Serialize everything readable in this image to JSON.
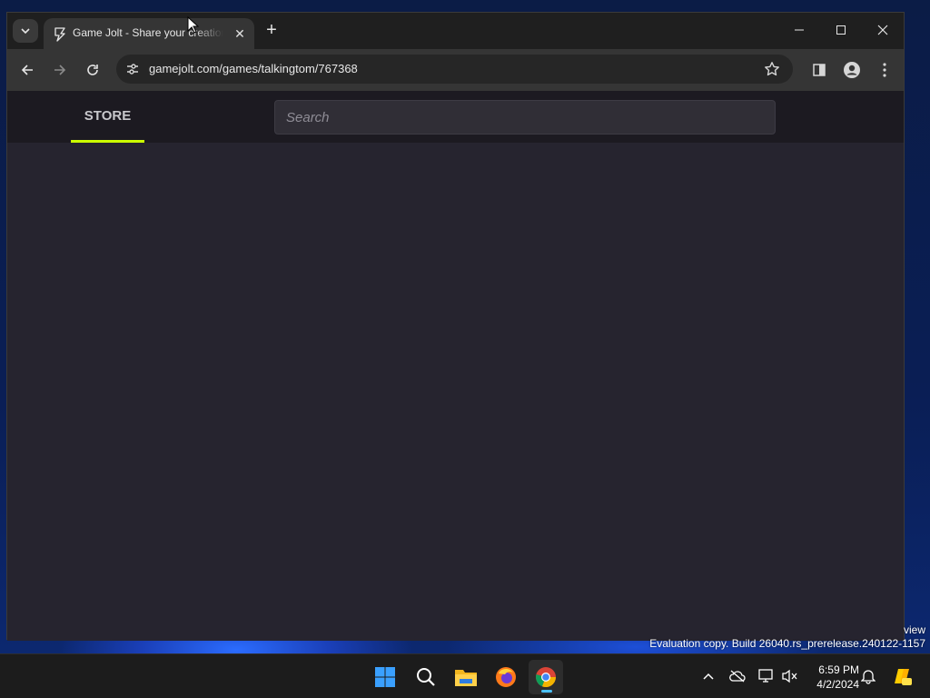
{
  "browser": {
    "tab": {
      "title": "Game Jolt - Share your creations",
      "close_glyph": "✕"
    },
    "new_tab_glyph": "+",
    "url": "gamejolt.com/games/talkingtom/767368",
    "icons": {
      "tab_search": "chevron-down-icon",
      "back": "arrow-left-icon",
      "forward": "arrow-right-icon",
      "reload": "reload-icon",
      "site_info": "tune-icon",
      "bookmark": "star-icon",
      "side_panel": "side-panel-icon",
      "profile": "profile-icon",
      "menu": "kebab-menu-icon"
    }
  },
  "site": {
    "nav": {
      "store_label": "STORE"
    },
    "search": {
      "placeholder": "Search"
    },
    "accent_color": "#ccff00"
  },
  "desktop": {
    "watermark_line1": "view",
    "watermark_line2": "Evaluation copy. Build 26040.rs_prerelease.240122-1157"
  },
  "taskbar": {
    "apps": [
      "start",
      "search",
      "file-explorer",
      "firefox",
      "chrome"
    ],
    "active_app": "chrome",
    "clock": {
      "time": "6:59 PM",
      "date": "4/2/2024"
    }
  }
}
